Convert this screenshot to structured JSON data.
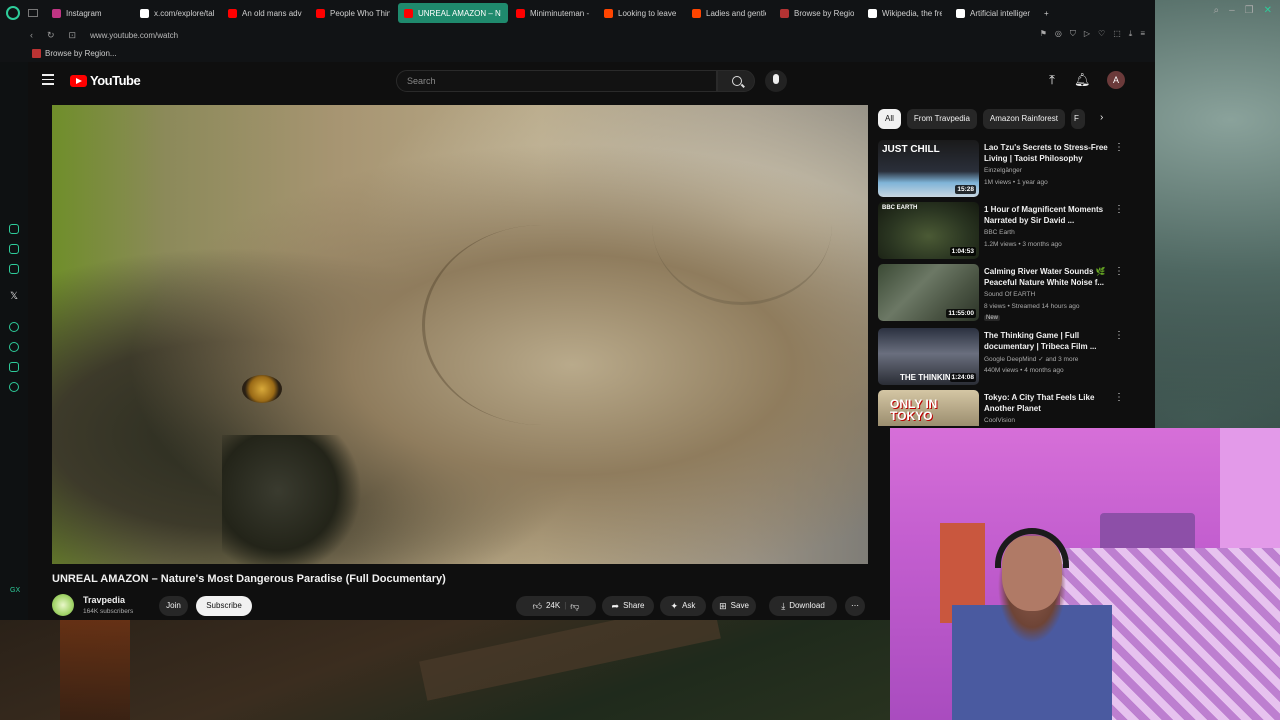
{
  "browser": {
    "tabs": [
      {
        "label": "Instagram",
        "color": "#c13584"
      },
      {
        "label": "x.com/explore/tab",
        "color": "#ffffff"
      },
      {
        "label": "An old mans advic",
        "color": "#ff0000"
      },
      {
        "label": "People Who Think",
        "color": "#ff0000"
      },
      {
        "label": "UNREAL AMAZON – N",
        "color": "#ff0000",
        "active": true
      },
      {
        "label": "Miniminuteman - Y",
        "color": "#ff0000"
      },
      {
        "label": "Looking to leave th",
        "color": "#ff4500"
      },
      {
        "label": "Ladies and gentlem",
        "color": "#ff4500"
      },
      {
        "label": "Browse by Region",
        "color": "#b33333"
      },
      {
        "label": "Wikipedia, the free",
        "color": "#ffffff"
      },
      {
        "label": "Artificial intelligenc",
        "color": "#ffffff"
      }
    ],
    "url": "www.youtube.com/watch",
    "bookmark": "Browse by Region..."
  },
  "youtube": {
    "logo": "YouTube",
    "search_placeholder": "Search",
    "avatar_letter": "A",
    "video": {
      "title": "UNREAL AMAZON – Nature's Most Dangerous Paradise (Full Documentary)",
      "channel": "Travpedia",
      "subscribers": "164K subscribers",
      "join": "Join",
      "subscribe": "Subscribe",
      "likes": "24K",
      "share": "Share",
      "ask": "Ask",
      "save": "Save",
      "download": "Download"
    },
    "chips": [
      "All",
      "From Travpedia",
      "Amazon Rainforest",
      "F"
    ],
    "recommendations": [
      {
        "title": "Lao Tzu's Secrets to Stress-Free Living | Taoist Philosophy",
        "channel": "Einzelgänger",
        "meta": "1M views • 1 year ago",
        "duration": "15:28",
        "thumb_text": "JUST CHILL",
        "badge": ""
      },
      {
        "title": "1 Hour of Magnificent Moments Narrated by Sir David ...",
        "channel": "BBC Earth",
        "meta": "1.2M views • 3 months ago",
        "duration": "1:04:53",
        "thumb_text": "BBC EARTH",
        "badge": ""
      },
      {
        "title": "Calming River Water Sounds 🌿 Peaceful Nature White Noise f...",
        "channel": "Sound Of EARTH",
        "meta": "8 views • Streamed 14 hours ago",
        "duration": "11:55:00",
        "thumb_text": "",
        "badge": "New"
      },
      {
        "title": "The Thinking Game | Full documentary | Tribeca Film ...",
        "channel": "Google DeepMind",
        "meta": "440M views • 4 months ago",
        "duration": "1:24:08",
        "thumb_text": "THE THINKING",
        "badge": "",
        "extra": "and 3 more"
      },
      {
        "title": "Tokyo: A City That Feels Like Another Planet",
        "channel": "CoolVision",
        "meta": "",
        "duration": "",
        "thumb_text": "ONLY IN TOKYO",
        "badge": ""
      }
    ]
  }
}
